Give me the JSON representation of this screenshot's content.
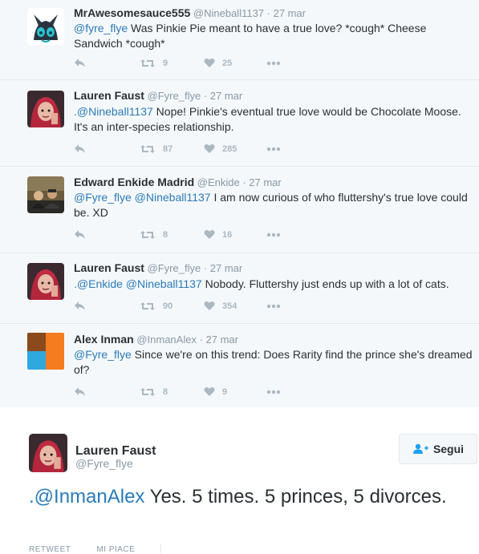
{
  "replies": [
    {
      "name": "MrAwesomesauce555",
      "handle": "@Nineball1137",
      "sep": " · ",
      "time": "27 mar",
      "mentions": "@fyre_flye",
      "text": " Was Pinkie Pie meant to have a true love? *cough* Cheese Sandwich *cough*",
      "retweets": "9",
      "likes": "25"
    },
    {
      "name": "Lauren Faust",
      "handle": "@Fyre_flye",
      "sep": " · ",
      "time": "27 mar",
      "mentions": ".@Nineball1137",
      "text": " Nope! Pinkie's eventual true love would be Chocolate Moose. It's an inter-species relationship.",
      "retweets": "87",
      "likes": "285"
    },
    {
      "name": "Edward Enkide Madrid",
      "handle": "@Enkide",
      "sep": " · ",
      "time": "27 mar",
      "mentions": "@Fyre_flye @Nineball1137",
      "text": " I am now curious of who fluttershy's true love could be. XD",
      "retweets": "8",
      "likes": "16"
    },
    {
      "name": "Lauren Faust",
      "handle": "@Fyre_flye",
      "sep": " · ",
      "time": "27 mar",
      "mentions": ".@Enkide @Nineball1137",
      "text": " Nobody. Fluttershy just ends up with a lot of cats.",
      "retweets": "90",
      "likes": "354"
    },
    {
      "name": "Alex Inman",
      "handle": "@InmanAlex",
      "sep": " · ",
      "time": "27 mar",
      "mentions": "@Fyre_flye",
      "text": " Since we're on this trend: Does Rarity find the prince she's dreamed of?",
      "retweets": "8",
      "likes": "9"
    }
  ],
  "main_tweet": {
    "name": "Lauren Faust",
    "handle": "@Fyre_flye",
    "follow_label": "Segui",
    "mention": ".@InmanAlex",
    "text": " Yes. 5 times. 5 princes, 5 divorces.",
    "stat_retweet": "RETWEET",
    "stat_like": "MI PIACE"
  },
  "colors": {
    "link": "#2b7bb9",
    "secondary": "#8899a6",
    "icon": "#aab8c2",
    "background": "#f5f8fa"
  },
  "icons": [
    "reply-icon",
    "retweet-icon",
    "heart-icon",
    "more-icon",
    "follow-person-icon"
  ]
}
